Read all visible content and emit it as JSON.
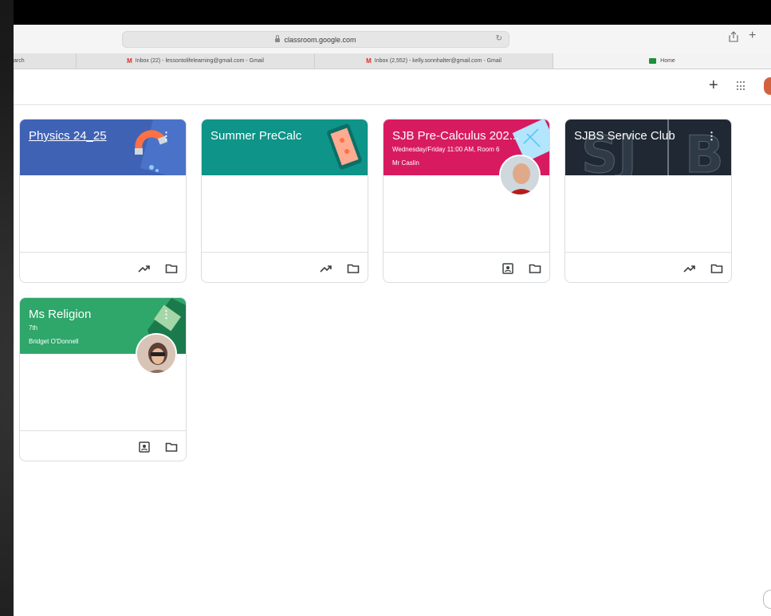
{
  "browser": {
    "url": "classroom.google.com",
    "tabs": [
      {
        "label": "arch",
        "icon": "",
        "active": false
      },
      {
        "label": "Inbox (22) - lessontolifelearning@gmail.com - Gmail",
        "icon": "gmail-icon",
        "active": false
      },
      {
        "label": "Inbox (2,552) - kelly.sonnhalter@gmail.com - Gmail",
        "icon": "gmail-icon",
        "active": false
      },
      {
        "label": "Home",
        "icon": "classroom-icon",
        "active": true
      }
    ]
  },
  "header": {
    "create_label": "+",
    "apps_icon": "apps-grid-icon"
  },
  "classes": [
    {
      "title": "Physics 24_25",
      "section": "",
      "teacher": "",
      "color": "#3f62b5",
      "underlined": true,
      "footer_icons": [
        "trending-icon",
        "folder-icon"
      ]
    },
    {
      "title": "Summer PreCalc",
      "section": "",
      "teacher": "",
      "color": "#0e9488",
      "underlined": false,
      "footer_icons": [
        "trending-icon",
        "folder-icon"
      ]
    },
    {
      "title": "SJB Pre-Calculus 202...",
      "section": "Wednesday/Friday 11:00 AM, Room 6",
      "teacher": "Mr Caslin",
      "color": "#d81b60",
      "underlined": false,
      "footer_icons": [
        "assignment-ind-icon",
        "folder-icon"
      ]
    },
    {
      "title": "SJBS Service Club",
      "section": "",
      "teacher": "",
      "color": "#1f2833",
      "underlined": false,
      "footer_icons": [
        "trending-icon",
        "folder-icon"
      ]
    },
    {
      "title": "Ms Religion",
      "section": "7th",
      "teacher": "Bridget O'Donnell",
      "color": "#2fa66a",
      "underlined": false,
      "footer_icons": [
        "assignment-ind-icon",
        "folder-icon"
      ]
    }
  ]
}
